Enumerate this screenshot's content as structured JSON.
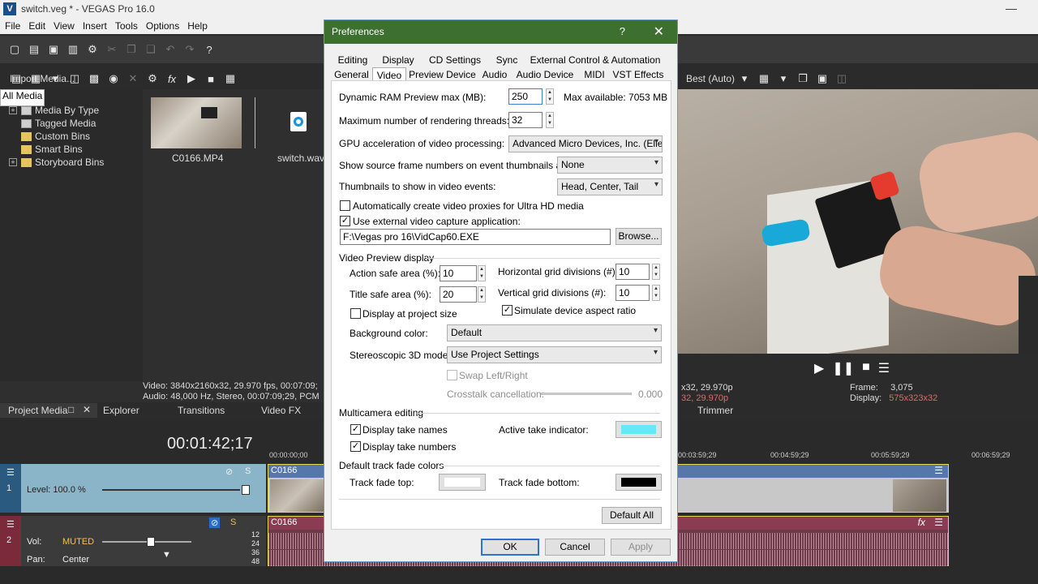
{
  "app": {
    "window_title": "switch.veg * - VEGAS Pro 16.0",
    "logo_letter": "V",
    "menus": [
      "File",
      "Edit",
      "View",
      "Insert",
      "Tools",
      "Options",
      "Help"
    ]
  },
  "media": {
    "import_label": "Import Media...",
    "tree": [
      {
        "label": "All Media",
        "expand": "minus",
        "selected": true
      },
      {
        "label": "Media By Type",
        "expand": "plus"
      },
      {
        "label": "Tagged Media",
        "expand": "none"
      },
      {
        "label": "Custom Bins",
        "expand": "none"
      },
      {
        "label": "Smart Bins",
        "expand": "none"
      },
      {
        "label": "Storyboard Bins",
        "expand": "plus"
      }
    ],
    "files": [
      {
        "name": "C0166.MP4"
      },
      {
        "name": "switch.wav"
      }
    ],
    "info_line1": "Video: 3840x2160x32, 29.970 fps, 00:07:09;",
    "info_line2": "Audio: 48,000 Hz, Stereo, 00:07:09;29, PCM",
    "tabs": [
      "Project Media",
      "Explorer",
      "Transitions",
      "Video FX"
    ]
  },
  "preview": {
    "quality": "Best (Auto)",
    "project_line1": "x32, 29.970p",
    "project_line2": "32, 29.970p",
    "frame_label": "Frame:",
    "frame_value": "3,075",
    "display_label": "Display:",
    "display_value": "575x323x32",
    "trimmer_tab": "Trimmer"
  },
  "timeline": {
    "timecode": "00:01:42;17",
    "ruler": [
      "00:00:00;00",
      "00:03:59;29",
      "00:04:59;29",
      "00:05:59;29",
      "00:06:59;29"
    ],
    "video_track": {
      "number": "1",
      "level": "Level: 100.0 %",
      "clip": "C0166"
    },
    "audio_track": {
      "number": "2",
      "vol_label": "Vol:",
      "vol_value": "MUTED",
      "pan_label": "Pan:",
      "pan_value": "Center",
      "clip": "C0166",
      "meter_labels": [
        "12",
        "24",
        "36",
        "48"
      ]
    }
  },
  "dialog": {
    "title": "Preferences",
    "help": "?",
    "close": "✕",
    "tabs_row1": [
      "Editing",
      "Display",
      "CD Settings",
      "Sync",
      "External Control & Automation"
    ],
    "tabs_row2": [
      "General",
      "Video",
      "Preview Device",
      "Audio",
      "Audio Device",
      "MIDI",
      "VST Effects"
    ],
    "active_tab": "Video",
    "ram_label": "Dynamic RAM Preview max (MB):",
    "ram_value": "250",
    "max_available": "Max available: 7053 MB",
    "threads_label": "Maximum number of rendering threads:",
    "threads_value": "32",
    "gpu_label": "GPU acceleration of video processing:",
    "gpu_value": "Advanced Micro Devices, Inc. (Elle",
    "frame_numbers_label": "Show source frame numbers on event thumbnails as:",
    "frame_numbers_value": "None",
    "thumbnails_label": "Thumbnails to show in video events:",
    "thumbnails_value": "Head, Center, Tail",
    "proxies_label": "Automatically create video proxies for Ultra HD media",
    "proxies_checked": false,
    "external_capture_label": "Use external video capture application:",
    "external_capture_checked": true,
    "capture_path": "F:\\Vegas pro 16\\VidCap60.EXE",
    "browse_label": "Browse...",
    "preview_section": "Video Preview display",
    "action_safe_label": "Action safe area (%):",
    "action_safe_value": "10",
    "title_safe_label": "Title safe area (%):",
    "title_safe_value": "20",
    "hgrid_label": "Horizontal grid divisions (#):",
    "hgrid_value": "10",
    "vgrid_label": "Vertical grid divisions (#):",
    "vgrid_value": "10",
    "project_size_label": "Display at project size",
    "project_size_checked": false,
    "aspect_label": "Simulate device aspect ratio",
    "aspect_checked": true,
    "bg_label": "Background color:",
    "bg_value": "Default",
    "stereo_label": "Stereoscopic 3D mode:",
    "stereo_value": "Use Project Settings",
    "swap_label": "Swap Left/Right",
    "crosstalk_label": "Crosstalk cancellation:",
    "crosstalk_value": "0.000",
    "multicam_section": "Multicamera editing",
    "take_names_label": "Display take names",
    "take_names_checked": true,
    "take_numbers_label": "Display take numbers",
    "take_numbers_checked": true,
    "take_indicator_label": "Active take indicator:",
    "take_indicator_color": "#66e8f7",
    "fade_section": "Default track fade colors",
    "fade_top_label": "Track fade top:",
    "fade_top_color": "#ffffff",
    "fade_bottom_label": "Track fade bottom:",
    "fade_bottom_color": "#000000",
    "default_all": "Default All",
    "ok": "OK",
    "cancel": "Cancel",
    "apply": "Apply",
    "check_mark": "✓"
  }
}
